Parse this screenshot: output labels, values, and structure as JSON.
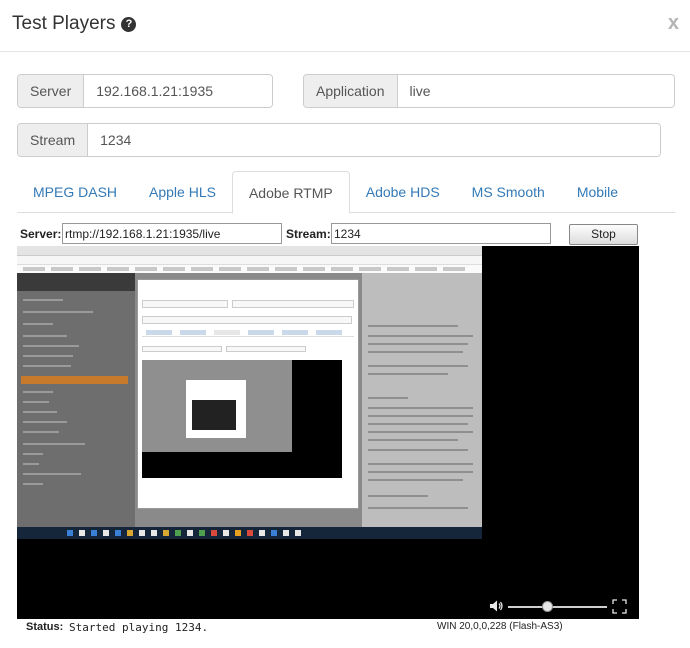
{
  "modal": {
    "title": "Test Players",
    "close_label": "x"
  },
  "icons": {
    "help": "question-circle-icon",
    "close": "close-icon",
    "volume": "volume-icon",
    "fullscreen": "fullscreen-icon"
  },
  "fields": {
    "server_label": "Server",
    "server_value": "192.168.1.21:1935",
    "application_label": "Application",
    "application_value": "live",
    "stream_label": "Stream",
    "stream_value": "1234"
  },
  "tabs": [
    {
      "label": "MPEG DASH",
      "active": false
    },
    {
      "label": "Apple HLS",
      "active": false
    },
    {
      "label": "Adobe RTMP",
      "active": true
    },
    {
      "label": "Adobe HDS",
      "active": false
    },
    {
      "label": "MS Smooth",
      "active": false
    },
    {
      "label": "Mobile",
      "active": false
    }
  ],
  "player": {
    "server_label": "Server:",
    "server_value": "rtmp://192.168.1.21:1935/live",
    "stream_label": "Stream:",
    "stream_value": "1234",
    "stop_label": "Stop",
    "volume_level": 0.4,
    "status_label": "Status:",
    "status_text": "Started playing 1234.",
    "version_text": "WIN 20,0,0,228 (Flash-AS3)"
  },
  "colors": {
    "link": "#337ab7",
    "addon_bg": "#eeeeee",
    "video_bg": "#000000"
  }
}
